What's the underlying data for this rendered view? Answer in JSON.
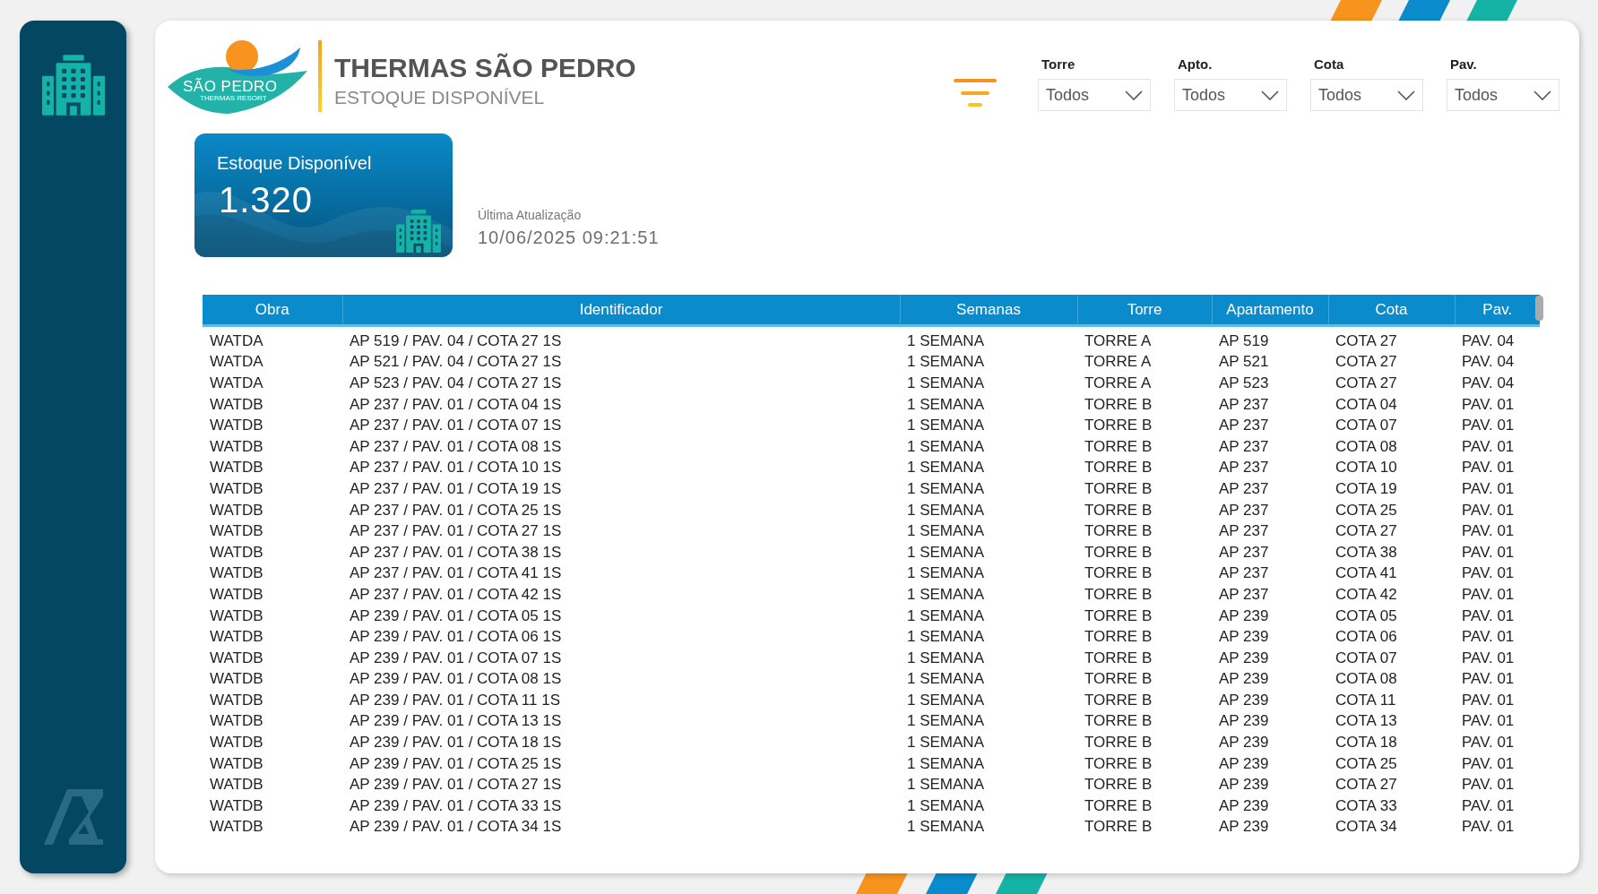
{
  "logo": {
    "name": "SÃO PEDRO",
    "tagline": "THERMAS RESORT"
  },
  "header": {
    "title": "THERMAS SÃO PEDRO",
    "subtitle": "ESTOQUE DISPONÍVEL"
  },
  "filters": [
    {
      "label": "Torre",
      "value": "Todos"
    },
    {
      "label": "Apto.",
      "value": "Todos"
    },
    {
      "label": "Cota",
      "value": "Todos"
    },
    {
      "label": "Pav.",
      "value": "Todos"
    }
  ],
  "kpi": {
    "label": "Estoque Disponível",
    "value": "1.320"
  },
  "last_update": {
    "label": "Última Atualização",
    "value": "10/06/2025 09:21:51"
  },
  "table": {
    "columns": [
      "Obra",
      "Identificador",
      "Semanas",
      "Torre",
      "Apartamento",
      "Cota",
      "Pav."
    ],
    "rows": [
      [
        "WATDA",
        "AP 519 / PAV. 04 / COTA 27 1S",
        "1 SEMANA",
        "TORRE A",
        "AP 519",
        "COTA 27",
        "PAV. 04"
      ],
      [
        "WATDA",
        "AP 521 / PAV. 04 / COTA 27 1S",
        "1 SEMANA",
        "TORRE A",
        "AP 521",
        "COTA 27",
        "PAV. 04"
      ],
      [
        "WATDA",
        "AP 523 / PAV. 04 / COTA 27 1S",
        "1 SEMANA",
        "TORRE A",
        "AP 523",
        "COTA 27",
        "PAV. 04"
      ],
      [
        "WATDB",
        "AP 237 / PAV. 01 / COTA 04 1S",
        "1 SEMANA",
        "TORRE B",
        "AP 237",
        "COTA 04",
        "PAV. 01"
      ],
      [
        "WATDB",
        "AP 237 / PAV. 01 / COTA 07 1S",
        "1 SEMANA",
        "TORRE B",
        "AP 237",
        "COTA 07",
        "PAV. 01"
      ],
      [
        "WATDB",
        "AP 237 / PAV. 01 / COTA 08 1S",
        "1 SEMANA",
        "TORRE B",
        "AP 237",
        "COTA 08",
        "PAV. 01"
      ],
      [
        "WATDB",
        "AP 237 / PAV. 01 / COTA 10 1S",
        "1 SEMANA",
        "TORRE B",
        "AP 237",
        "COTA 10",
        "PAV. 01"
      ],
      [
        "WATDB",
        "AP 237 / PAV. 01 / COTA 19 1S",
        "1 SEMANA",
        "TORRE B",
        "AP 237",
        "COTA 19",
        "PAV. 01"
      ],
      [
        "WATDB",
        "AP 237 / PAV. 01 / COTA 25 1S",
        "1 SEMANA",
        "TORRE B",
        "AP 237",
        "COTA 25",
        "PAV. 01"
      ],
      [
        "WATDB",
        "AP 237 / PAV. 01 / COTA 27 1S",
        "1 SEMANA",
        "TORRE B",
        "AP 237",
        "COTA 27",
        "PAV. 01"
      ],
      [
        "WATDB",
        "AP 237 / PAV. 01 / COTA 38 1S",
        "1 SEMANA",
        "TORRE B",
        "AP 237",
        "COTA 38",
        "PAV. 01"
      ],
      [
        "WATDB",
        "AP 237 / PAV. 01 / COTA 41 1S",
        "1 SEMANA",
        "TORRE B",
        "AP 237",
        "COTA 41",
        "PAV. 01"
      ],
      [
        "WATDB",
        "AP 237 / PAV. 01 / COTA 42 1S",
        "1 SEMANA",
        "TORRE B",
        "AP 237",
        "COTA 42",
        "PAV. 01"
      ],
      [
        "WATDB",
        "AP 239 / PAV. 01 / COTA 05 1S",
        "1 SEMANA",
        "TORRE B",
        "AP 239",
        "COTA 05",
        "PAV. 01"
      ],
      [
        "WATDB",
        "AP 239 / PAV. 01 / COTA 06 1S",
        "1 SEMANA",
        "TORRE B",
        "AP 239",
        "COTA 06",
        "PAV. 01"
      ],
      [
        "WATDB",
        "AP 239 / PAV. 01 / COTA 07 1S",
        "1 SEMANA",
        "TORRE B",
        "AP 239",
        "COTA 07",
        "PAV. 01"
      ],
      [
        "WATDB",
        "AP 239 / PAV. 01 / COTA 08 1S",
        "1 SEMANA",
        "TORRE B",
        "AP 239",
        "COTA 08",
        "PAV. 01"
      ],
      [
        "WATDB",
        "AP 239 / PAV. 01 / COTA 11 1S",
        "1 SEMANA",
        "TORRE B",
        "AP 239",
        "COTA 11",
        "PAV. 01"
      ],
      [
        "WATDB",
        "AP 239 / PAV. 01 / COTA 13 1S",
        "1 SEMANA",
        "TORRE B",
        "AP 239",
        "COTA 13",
        "PAV. 01"
      ],
      [
        "WATDB",
        "AP 239 / PAV. 01 / COTA 18 1S",
        "1 SEMANA",
        "TORRE B",
        "AP 239",
        "COTA 18",
        "PAV. 01"
      ],
      [
        "WATDB",
        "AP 239 / PAV. 01 / COTA 25 1S",
        "1 SEMANA",
        "TORRE B",
        "AP 239",
        "COTA 25",
        "PAV. 01"
      ],
      [
        "WATDB",
        "AP 239 / PAV. 01 / COTA 27 1S",
        "1 SEMANA",
        "TORRE B",
        "AP 239",
        "COTA 27",
        "PAV. 01"
      ],
      [
        "WATDB",
        "AP 239 / PAV. 01 / COTA 33 1S",
        "1 SEMANA",
        "TORRE B",
        "AP 239",
        "COTA 33",
        "PAV. 01"
      ],
      [
        "WATDB",
        "AP 239 / PAV. 01 / COTA 34 1S",
        "1 SEMANA",
        "TORRE B",
        "AP 239",
        "COTA 34",
        "PAV. 01"
      ]
    ]
  }
}
